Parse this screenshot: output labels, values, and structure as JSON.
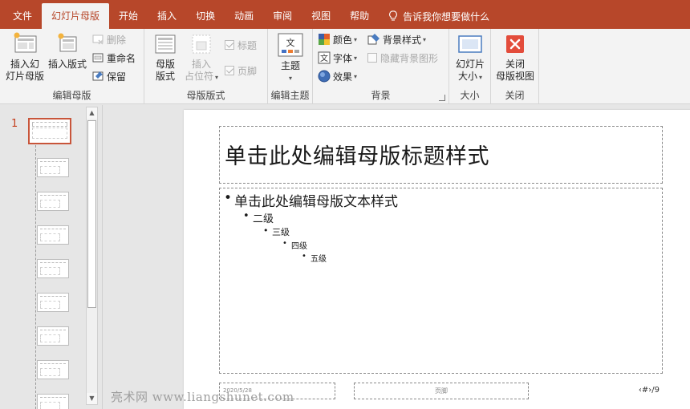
{
  "tabs": [
    {
      "label": "文件"
    },
    {
      "label": "幻灯片母版"
    },
    {
      "label": "开始"
    },
    {
      "label": "插入"
    },
    {
      "label": "切换"
    },
    {
      "label": "动画"
    },
    {
      "label": "审阅"
    },
    {
      "label": "视图"
    },
    {
      "label": "帮助"
    }
  ],
  "tellme": {
    "label": "告诉我你想要做什么"
  },
  "ribbon": {
    "edit_master": {
      "label": "编辑母版",
      "insert_master": "插入幻\n灯片母版",
      "insert_layout": "插入版式",
      "delete": "删除",
      "rename": "重命名",
      "preserve": "保留"
    },
    "master_layout": {
      "label": "母版版式",
      "master_layout_btn": "母版\n版式",
      "insert_placeholder": "插入\n占位符",
      "title": "标题",
      "footer": "页脚"
    },
    "edit_theme": {
      "label": "编辑主题",
      "theme": "主题"
    },
    "background": {
      "label": "背景",
      "colors": "颜色",
      "fonts": "字体",
      "effects": "效果",
      "bg_styles": "背景样式",
      "hide_bg": "隐藏背景图形",
      "theme_icon_text": "文"
    },
    "size": {
      "label": "大小",
      "slide_size": "幻灯片\n大小"
    },
    "close": {
      "label": "关闭",
      "close_master": "关闭\n母版视图"
    }
  },
  "thumbnails": {
    "first_number": "1",
    "layout_count": 9
  },
  "slide": {
    "title": "单击此处编辑母版标题样式",
    "body": {
      "l1": "单击此处编辑母版文本样式",
      "l2": "二级",
      "l3": "三级",
      "l4": "四级",
      "l5": "五级"
    },
    "date": "2020/5/28",
    "footer": "页脚",
    "number": "‹#›/9"
  },
  "watermark": "亮术网 www.liangshunet.com",
  "colors": {
    "accent": "#b7472a",
    "close_red": "#e34c3b"
  }
}
